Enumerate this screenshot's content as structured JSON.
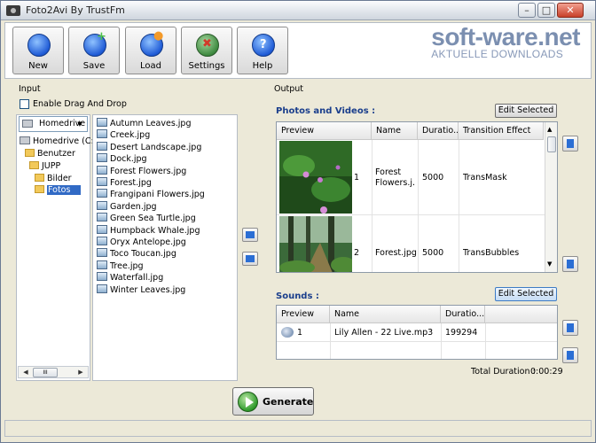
{
  "window": {
    "title": "Foto2Avi By TrustFm"
  },
  "toolbar": {
    "buttons": [
      {
        "label": "New",
        "icon": "new-icon"
      },
      {
        "label": "Save",
        "icon": "save-icon"
      },
      {
        "label": "Load",
        "icon": "load-icon"
      },
      {
        "label": "Settings",
        "icon": "settings-icon"
      },
      {
        "label": "Help",
        "icon": "help-icon"
      }
    ]
  },
  "watermark": {
    "name": "soft-ware.net",
    "tagline": "AKTUELLE DOWNLOADS"
  },
  "input": {
    "label": "Input",
    "drag_drop_label": "Enable Drag And Drop",
    "drag_drop_checked": false,
    "drive_combo": "Homedrive",
    "tree": [
      "Homedrive (C:)",
      "Benutzer",
      "JUPP",
      "Bilder",
      "Fotos"
    ],
    "selected_folder": "Fotos",
    "files": [
      "Autumn Leaves.jpg",
      "Creek.jpg",
      "Desert Landscape.jpg",
      "Dock.jpg",
      "Forest Flowers.jpg",
      "Forest.jpg",
      "Frangipani Flowers.jpg",
      "Garden.jpg",
      "Green Sea Turtle.jpg",
      "Humpback Whale.jpg",
      "Oryx Antelope.jpg",
      "Toco Toucan.jpg",
      "Tree.jpg",
      "Waterfall.jpg",
      "Winter Leaves.jpg"
    ],
    "scroll_thumb": "III"
  },
  "output": {
    "label": "Output",
    "photos": {
      "title": "Photos and Videos :",
      "edit_label": "Edit Selected",
      "columns": [
        "Preview",
        "Name",
        "Duratio...",
        "Transition Effect"
      ],
      "rows": [
        {
          "index": "1",
          "name": "Forest Flowers.j...",
          "duration": "5000",
          "effect": "TransMask"
        },
        {
          "index": "2",
          "name": "Forest.jpg",
          "duration": "5000",
          "effect": "TransBubbles"
        }
      ]
    },
    "sounds": {
      "title": "Sounds :",
      "edit_label": "Edit Selected",
      "columns": [
        "Preview",
        "Name",
        "Duratio..."
      ],
      "rows": [
        {
          "index": "1",
          "name": "Lily Allen - 22 Live.mp3",
          "duration": "199294"
        }
      ],
      "total_label": "Total Duration :",
      "total_value": "0:00:29"
    }
  },
  "generate": {
    "label": "Generate"
  }
}
